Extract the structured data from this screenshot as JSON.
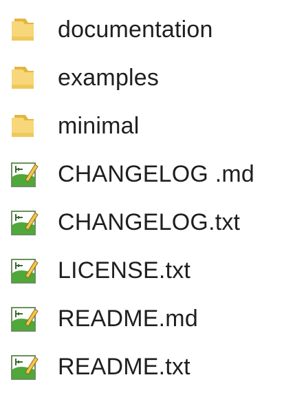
{
  "items": [
    {
      "name": "documentation",
      "type": "folder"
    },
    {
      "name": "examples",
      "type": "folder"
    },
    {
      "name": "minimal",
      "type": "folder"
    },
    {
      "name": "CHANGELOG .md",
      "type": "file"
    },
    {
      "name": "CHANGELOG.txt",
      "type": "file"
    },
    {
      "name": "LICENSE.txt",
      "type": "file"
    },
    {
      "name": "README.md",
      "type": "file"
    },
    {
      "name": "README.txt",
      "type": "file"
    }
  ],
  "icons": {
    "folder": "folder-icon",
    "file": "notepad-plus-plus-file-icon"
  },
  "colors": {
    "folder_light": "#f7d77a",
    "folder_dark": "#e4b63e",
    "file_green": "#4fa83a",
    "text": "#1f1f1f"
  }
}
